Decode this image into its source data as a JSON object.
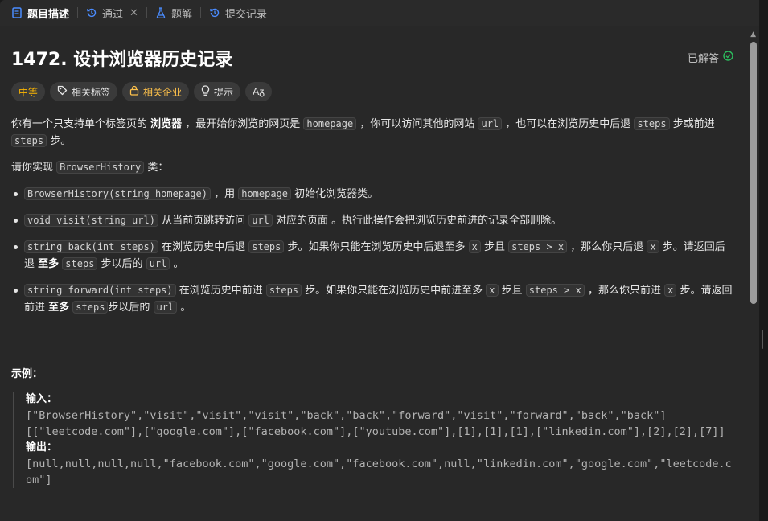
{
  "tabs": [
    {
      "label": "题目描述",
      "icon": "document-icon",
      "active": true
    },
    {
      "label": "通过",
      "icon": "history-icon",
      "active": false
    },
    {
      "label": "题解",
      "icon": "flask-icon",
      "active": false
    },
    {
      "label": "提交记录",
      "icon": "history-icon",
      "active": false
    }
  ],
  "problem": {
    "title": "1472. 设计浏览器历史记录",
    "solved_label": "已解答"
  },
  "tags": {
    "difficulty": "中等",
    "related_tags": "相关标签",
    "related_companies": "相关企业",
    "hint": "提示",
    "translate": "Aᵹ"
  },
  "desc": {
    "p1": [
      "你有一个只支持单个标签页的 ",
      "浏览器",
      " ，最开始你浏览的网页是 ",
      "homepage",
      " ，你可以访问其他的网站 ",
      "url",
      " ，也可以在浏览历史中后退 ",
      "steps",
      " 步或前进 ",
      "steps",
      " 步。"
    ],
    "p2": [
      "请你实现 ",
      "BrowserHistory",
      " 类："
    ],
    "b1": [
      "BrowserHistory(string homepage)",
      " ，用 ",
      "homepage",
      " 初始化浏览器类。"
    ],
    "b2": [
      "void visit(string url)",
      " 从当前页跳转访问 ",
      "url",
      " 对应的页面 。执行此操作会把浏览历史前进的记录全部删除。"
    ],
    "b3": [
      "string back(int steps)",
      " 在浏览历史中后退 ",
      "steps",
      " 步。如果你只能在浏览历史中后退至多 ",
      "x",
      " 步且 ",
      "steps > x",
      " ，那么你只后退 ",
      "x",
      " 步。请返回后退 ",
      "至多",
      " ",
      "steps",
      " 步以后的 ",
      "url",
      " 。"
    ],
    "b4": [
      "string forward(int steps)",
      " 在浏览历史中前进 ",
      "steps",
      " 步。如果你只能在浏览历史中前进至多 ",
      "x",
      " 步且 ",
      "steps > x",
      " ，那么你只前进 ",
      "x",
      " 步。请返回前进 ",
      "至多",
      " ",
      "steps",
      "步以后的 ",
      "url",
      " 。"
    ]
  },
  "example": {
    "heading": "示例：",
    "input_label": "输入：",
    "input_line1": "[\"BrowserHistory\",\"visit\",\"visit\",\"visit\",\"back\",\"back\",\"forward\",\"visit\",\"forward\",\"back\",\"back\"]",
    "input_line2": "[[\"leetcode.com\"],[\"google.com\"],[\"facebook.com\"],[\"youtube.com\"],[1],[1],[1],[\"linkedin.com\"],[2],[2],[7]]",
    "output_label": "输出：",
    "output_line": "[null,null,null,null,\"facebook.com\",\"google.com\",\"facebook.com\",null,\"linkedin.com\",\"google.com\",\"leetcode.com\"]"
  },
  "colors": {
    "background": "#282828",
    "difficulty": "#ffb800",
    "solved_check": "#2cbb5d"
  }
}
